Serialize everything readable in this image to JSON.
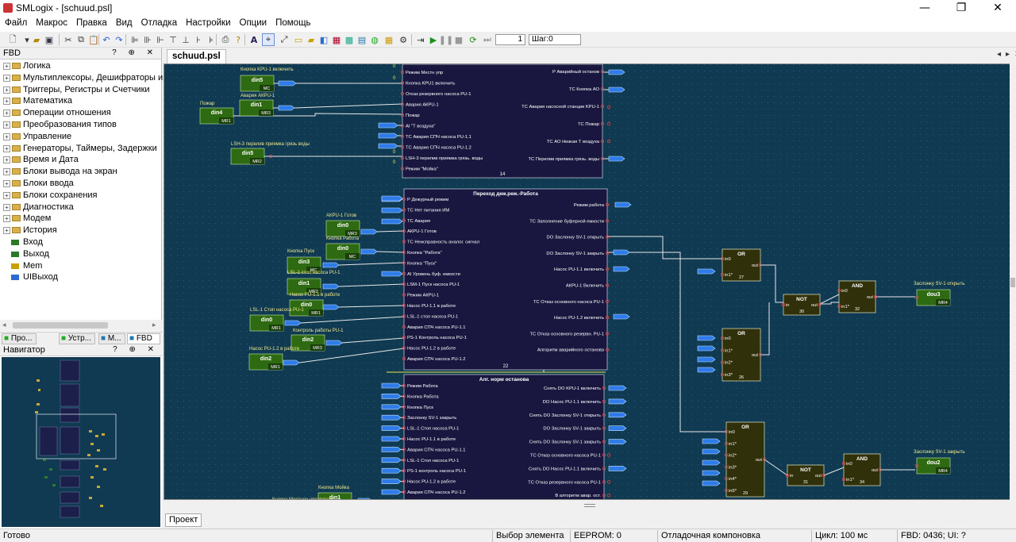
{
  "app": {
    "title": "SMLogix - [schuud.psl]"
  },
  "menu": [
    "Файл",
    "Макрос",
    "Правка",
    "Вид",
    "Отладка",
    "Настройки",
    "Опции",
    "Помощь"
  ],
  "toolbar": {
    "step_value": "1",
    "step_label": "Шаг:0"
  },
  "panel": {
    "title": "FBD",
    "buttons": "? ⊕ ✕"
  },
  "tree": [
    "Логика",
    "Мультиплексоры, Дешифраторы и Де",
    "Триггеры, Регистры и Счетчики",
    "Математика",
    "Операции отношения",
    "Преобразования типов",
    "Управление",
    "Генераторы, Таймеры, Задержки",
    "Время и Дата",
    "Блоки вывода на экран",
    "Блоки ввода",
    "Блоки сохранения",
    "Диагностика",
    "Модем",
    "История"
  ],
  "tree_leaves": [
    "Вход",
    "Выход",
    "Mem",
    "UIВыход"
  ],
  "bottom_tabs": [
    "Про...",
    "Устр...",
    "М...",
    "FBD"
  ],
  "navigator": {
    "title": "Навигатор"
  },
  "doc_tab": "schuud.psl",
  "project_tab": "Проект",
  "status": [
    "Готово",
    "Выбор элемента",
    "EEPROM: 0",
    "Отладочная компоновка",
    "Цикл: 100 мс",
    "FBD: 0436; UI: ?"
  ],
  "diagram": {
    "labels": [
      "Кнопка KPU-1 включить",
      "Авария АКРU-1",
      "Пожар",
      "LSH-3 перелив приямка грязь воды",
      "АКРU-1 Готов",
      "Кнопка Работа",
      "Кнопка Пуск",
      "LSL-1 стол насоса PU-1",
      "Насос PU-1.1 в работе",
      "LSL-1 Стоп насоса PU-1",
      "Контроль работы PU-1",
      "Насос PU-1.2 в работе",
      "Кнопка Мойка",
      "Кнопка Местное управление",
      "Заслонку SV-1 открыть",
      "Заслонку SV-1 закрыть"
    ],
    "din_blocks": [
      {
        "name": "din5",
        "tag": "MC"
      },
      {
        "name": "din1",
        "tag": "MR3"
      },
      {
        "name": "din4",
        "tag": "MR1"
      },
      {
        "name": "din5",
        "tag": "MR2"
      },
      {
        "name": "din0",
        "tag": "MR3"
      },
      {
        "name": "din0",
        "tag": "MC"
      },
      {
        "name": "din3",
        "tag": "MC"
      },
      {
        "name": "din1",
        "tag": "MR2"
      },
      {
        "name": "din0",
        "tag": "MR1"
      },
      {
        "name": "din0",
        "tag": "MR1"
      },
      {
        "name": "din2",
        "tag": "MR3"
      },
      {
        "name": "din2",
        "tag": "MR1"
      },
      {
        "name": "din1",
        "tag": ""
      }
    ],
    "dout_blocks": [
      {
        "name": "dou3",
        "tag": "MR4"
      },
      {
        "name": "dou2",
        "tag": "MR4"
      }
    ],
    "macro1": {
      "num": "14",
      "inputs": [
        "Режим Местн упр",
        "Кнопка KPU1 включить",
        "Отказ резервного насоса PU-1",
        "Авария АКРU-1",
        "Пожар",
        "AI \"Т воздуха\"",
        "ТС Авария СПЧ насоса PU-1.1",
        "ТС Авария СПЧ насоса PU-1.2",
        "LSH-3 перелив приямка грязь. воды",
        "Режим \"Мойка\""
      ],
      "outputs": [
        "Р Аварийный останов",
        "ТС Кнопка АО",
        "ТС Авария насосной станции KPU-1",
        "ТС Пожар",
        "ТС АО Низкая Т воздуха",
        "ТС Перелив приямка грязь. воды"
      ]
    },
    "macro2": {
      "title": "Переход деж.реж.-Работа",
      "num": "22",
      "inputs": [
        "Р Дежурный режим",
        "ТС Нет питания ИМ",
        "ТС Авария",
        "АКРU-1 Готов",
        "ТС Неисправность аналог. сигнал",
        "Кнопка \"Работа\"",
        "Кнопка \"Пуск\"",
        "AI Уровень буф. емкости",
        "LSM-1 Пуск насоса PU-1",
        "Режим АКРU-1",
        "Насос PU-1.1 в работе",
        "LSL-1 стол насоса PU-1",
        "Авария СПЧ насоса PU-1.1",
        "PS-1 Контроль насоса PU-1",
        "Насос PU-1.2 в работе",
        "Авария СПЧ насоса PU-1.2"
      ],
      "outputs": [
        "Режим работа",
        "ТС Заполнение буферной емкости",
        "DO Заслонку SV-1 открыть",
        "DO Заслонку SV-1 закрыть",
        "Насос PU-1.1 включить",
        "АКРU-1 Включить",
        "ТС Отказ основного насоса PU-1",
        "Насос PU-1.2 включить",
        "ТС Отказ основного резервн. PU-1",
        "Алгоритм аварийного останова"
      ]
    },
    "macro3": {
      "title": "Алг. норм останова",
      "inputs": [
        "Режим Работа",
        "Кнопка Работа",
        "Кнопка Пуск",
        "Заслонку SV-1 закрыть",
        "LSL-1 Стоп насоса PU-1",
        "Насос PU-1.1 в работе",
        "Авария СПЧ насоса PU-1.1",
        "LSL-1 Стоп насоса PU-1",
        "PS-1 контроль насоса PU-1",
        "Насос PU-1.2 в работе",
        "Авария СПЧ насоса PU-1.2"
      ],
      "outputs": [
        "Снять DO KPU-1 включить",
        "DO Насос PU-1.1 включить",
        "Снять DO Заслонку SV-1 открыть",
        "DO Заслонку SV-1 закрыть",
        "Снять DO Заслонку SV-1 закрыть",
        "ТС Отказ основного насоса PU-1",
        "Снять DO Насос PU-1.1 включить",
        "ТС Отказ резервного насоса PU-1",
        "В алгоритм авар. ост."
      ]
    },
    "logic": [
      {
        "type": "OR",
        "num": "27",
        "inputs": [
          "in0",
          "in1*"
        ],
        "output": "out"
      },
      {
        "type": "OR",
        "num": "26",
        "inputs": [
          "in0",
          "in1*",
          "in2*",
          "in3*"
        ],
        "output": "out"
      },
      {
        "type": "OR",
        "num": "29",
        "inputs": [
          "in0",
          "in1*",
          "in2*",
          "in3*",
          "in4*",
          "in5*"
        ],
        "output": "out"
      },
      {
        "type": "NOT",
        "num": "30",
        "inputs": [
          "in"
        ],
        "output": "out"
      },
      {
        "type": "NOT",
        "num": "31",
        "inputs": [
          "in"
        ],
        "output": "out"
      },
      {
        "type": "AND",
        "num": "32",
        "inputs": [
          "in0",
          "in1*"
        ],
        "output": "out"
      },
      {
        "type": "AND",
        "num": "34",
        "inputs": [
          "in0",
          "in1*"
        ],
        "output": "out"
      }
    ],
    "constants": [
      "0",
      "0",
      "0",
      "0"
    ]
  }
}
